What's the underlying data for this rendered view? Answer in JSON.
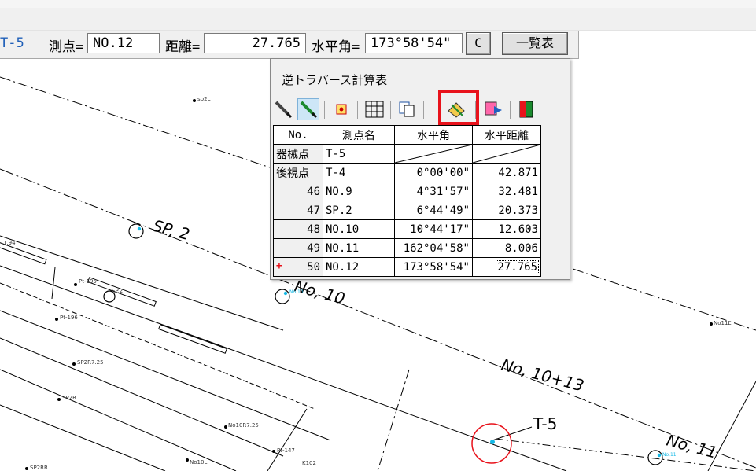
{
  "toolbar": {
    "station_prefix": "T-5",
    "point_label": "測点=",
    "point_value": "NO.12",
    "distance_label": "距離=",
    "distance_value": "27.765",
    "angle_label": "水平角=",
    "angle_value": "173°58'54\"",
    "clear_button": "C",
    "list_button": "一覧表"
  },
  "popup": {
    "title": "逆トラバース計算表",
    "toolbar_icons": [
      "pencil-icon",
      "pencil-active-icon",
      "point-marker-icon",
      "table-grid-icon",
      "copy-icon",
      "compass-icon",
      "export-icon",
      "color-fill-icon"
    ],
    "columns": [
      "No.",
      "測点名",
      "水平角",
      "水平距離"
    ],
    "rows": [
      {
        "no": "器械点",
        "name": "T-5",
        "angle": "",
        "distance": ""
      },
      {
        "no": "後視点",
        "name": "T-4",
        "angle": "0°00'00\"",
        "distance": "42.871"
      },
      {
        "no": "46",
        "name": "NO.9",
        "angle": "4°31'57\"",
        "distance": "32.481"
      },
      {
        "no": "47",
        "name": "SP.2",
        "angle": "6°44'49\"",
        "distance": "20.373"
      },
      {
        "no": "48",
        "name": "NO.10",
        "angle": "10°44'17\"",
        "distance": "12.603"
      },
      {
        "no": "49",
        "name": "NO.11",
        "angle": "162°04'58\"",
        "distance": "8.006"
      },
      {
        "no": "50",
        "name": "NO.12",
        "angle": "173°58'54\"",
        "distance": "27.765"
      }
    ]
  },
  "map": {
    "labels": {
      "sp2": "SP, 2",
      "no10": "No, 10",
      "no1013": "No, 10+13",
      "t5": "T-5",
      "no11": "No, 11",
      "sp2l": "sp2L",
      "no11l": "No11L",
      "pt195": "Pt-195",
      "pt196": "Pt-196",
      "sp2b": "SP.2",
      "no10s": "No.10",
      "sp2r": "SP2R",
      "sp2_25": "SP2R7.25",
      "no10_25": "No10R7.25",
      "no10l": "No10L",
      "pt147": "Pt-147",
      "k102": "K102",
      "sp2rr": "SP2RR",
      "i94": "1.94",
      "no11s": "No.11"
    },
    "colors": {
      "accent_circle": "#e8121b",
      "point": "#14b9e6",
      "line": "#000000"
    }
  }
}
